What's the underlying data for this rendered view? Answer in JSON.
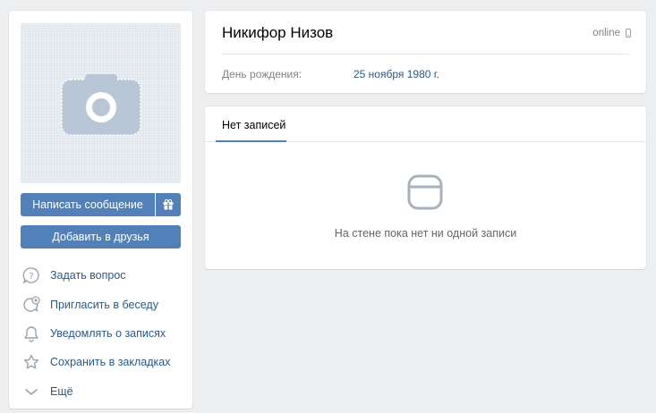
{
  "profile": {
    "name": "Никифор Низов",
    "status": "online",
    "birthday_label": "День рождения:",
    "birthday_value": "25 ноября 1980 г."
  },
  "buttons": {
    "message": "Написать сообщение",
    "add_friend": "Добавить в друзья"
  },
  "actions": [
    {
      "label": "Задать вопрос",
      "icon": "question-icon"
    },
    {
      "label": "Пригласить в беседу",
      "icon": "invite-chat-icon"
    },
    {
      "label": "Уведомлять о записях",
      "icon": "bell-icon"
    },
    {
      "label": "Сохранить в закладках",
      "icon": "star-icon"
    },
    {
      "label": "Ещё",
      "icon": "chevron-down-icon"
    }
  ],
  "wall": {
    "tab_label": "Нет записей",
    "empty_text": "На стене пока нет ни одной записи"
  },
  "colors": {
    "accent": "#5181b8",
    "link": "#2a5885",
    "background": "#edeef0"
  }
}
